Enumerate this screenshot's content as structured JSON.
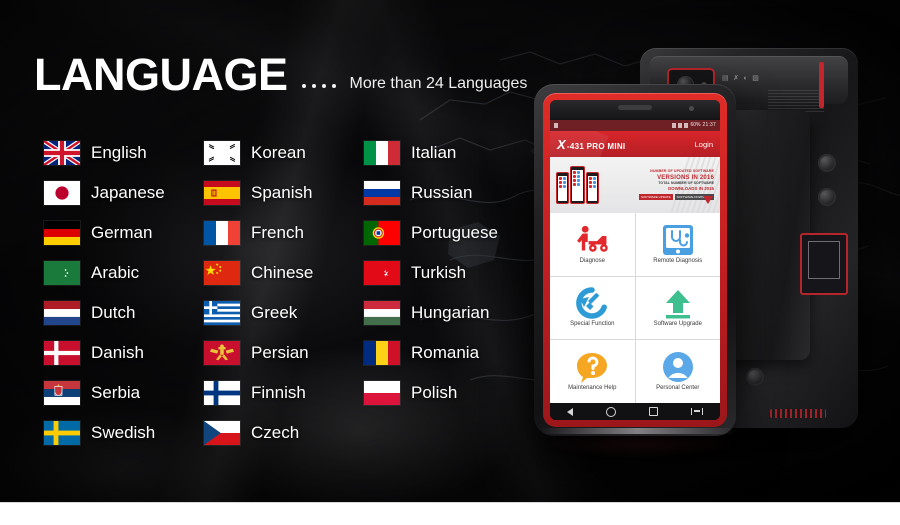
{
  "header": {
    "title": "LANGUAGE",
    "subtitle": "More than 24 Languages",
    "dot_count": 4
  },
  "languages": [
    {
      "name": "English",
      "flag": "uk"
    },
    {
      "name": "Korean",
      "flag": "korea"
    },
    {
      "name": "Italian",
      "flag": "italy"
    },
    {
      "name": "Japanese",
      "flag": "japan"
    },
    {
      "name": "Spanish",
      "flag": "spain"
    },
    {
      "name": "Russian",
      "flag": "russia"
    },
    {
      "name": "German",
      "flag": "germany"
    },
    {
      "name": "French",
      "flag": "france"
    },
    {
      "name": "Portuguese",
      "flag": "portugal"
    },
    {
      "name": "Arabic",
      "flag": "arabic"
    },
    {
      "name": "Chinese",
      "flag": "china"
    },
    {
      "name": "Turkish",
      "flag": "turkey"
    },
    {
      "name": "Dutch",
      "flag": "netherlands"
    },
    {
      "name": "Greek",
      "flag": "greece"
    },
    {
      "name": "Hungarian",
      "flag": "hungary"
    },
    {
      "name": "Danish",
      "flag": "denmark"
    },
    {
      "name": "Persian",
      "flag": "persia"
    },
    {
      "name": "Romania",
      "flag": "romania"
    },
    {
      "name": "Serbia",
      "flag": "serbia"
    },
    {
      "name": "Finnish",
      "flag": "finland"
    },
    {
      "name": "Polish",
      "flag": "poland"
    },
    {
      "name": "Swedish",
      "flag": "sweden"
    },
    {
      "name": "Czech",
      "flag": "czech"
    },
    {
      "name": "",
      "flag": ""
    }
  ],
  "device": {
    "status_bar": {
      "battery": "60%",
      "clock": "21:37"
    },
    "app_bar": {
      "brand_x": "X",
      "brand_rest": "-431 PRO MINI",
      "login_label": "Login"
    },
    "banner": {
      "line1": "NUMBER OF UPDATED SOFTWARE",
      "line2": "VERSIONS IN 2016",
      "line3": "TOTAL NUMBER OF SOFTWARE",
      "line4": "DOWNLOADS IN 2016",
      "tag1": "SOFTWARE UPDATE",
      "tag2": "SOFTWARE DOWNLOAD"
    },
    "menu": [
      {
        "label": "Diagnose",
        "icon": "mechanic-car-icon",
        "color": "#e0282d"
      },
      {
        "label": "Remote Diagnosis",
        "icon": "stethoscope-tablet-icon",
        "color": "#4a9fe0"
      },
      {
        "label": "Special Function",
        "icon": "wrench-refresh-icon",
        "color": "#2d9bd6"
      },
      {
        "label": "Software Upgrade",
        "icon": "upload-arrow-icon",
        "color": "#3fbf8f"
      },
      {
        "label": "Maintenance Help",
        "icon": "question-bubble-icon",
        "color": "#f5a623"
      },
      {
        "label": "Personal Center",
        "icon": "user-avatar-icon",
        "color": "#5ba8e8"
      }
    ],
    "nav": [
      {
        "name": "back-nav-icon"
      },
      {
        "name": "home-nav-icon"
      },
      {
        "name": "recent-apps-nav-icon"
      },
      {
        "name": "split-screen-nav-icon"
      }
    ]
  },
  "colors": {
    "brand_red": "#c0272d",
    "background": "#050506",
    "text": "#ffffff"
  }
}
